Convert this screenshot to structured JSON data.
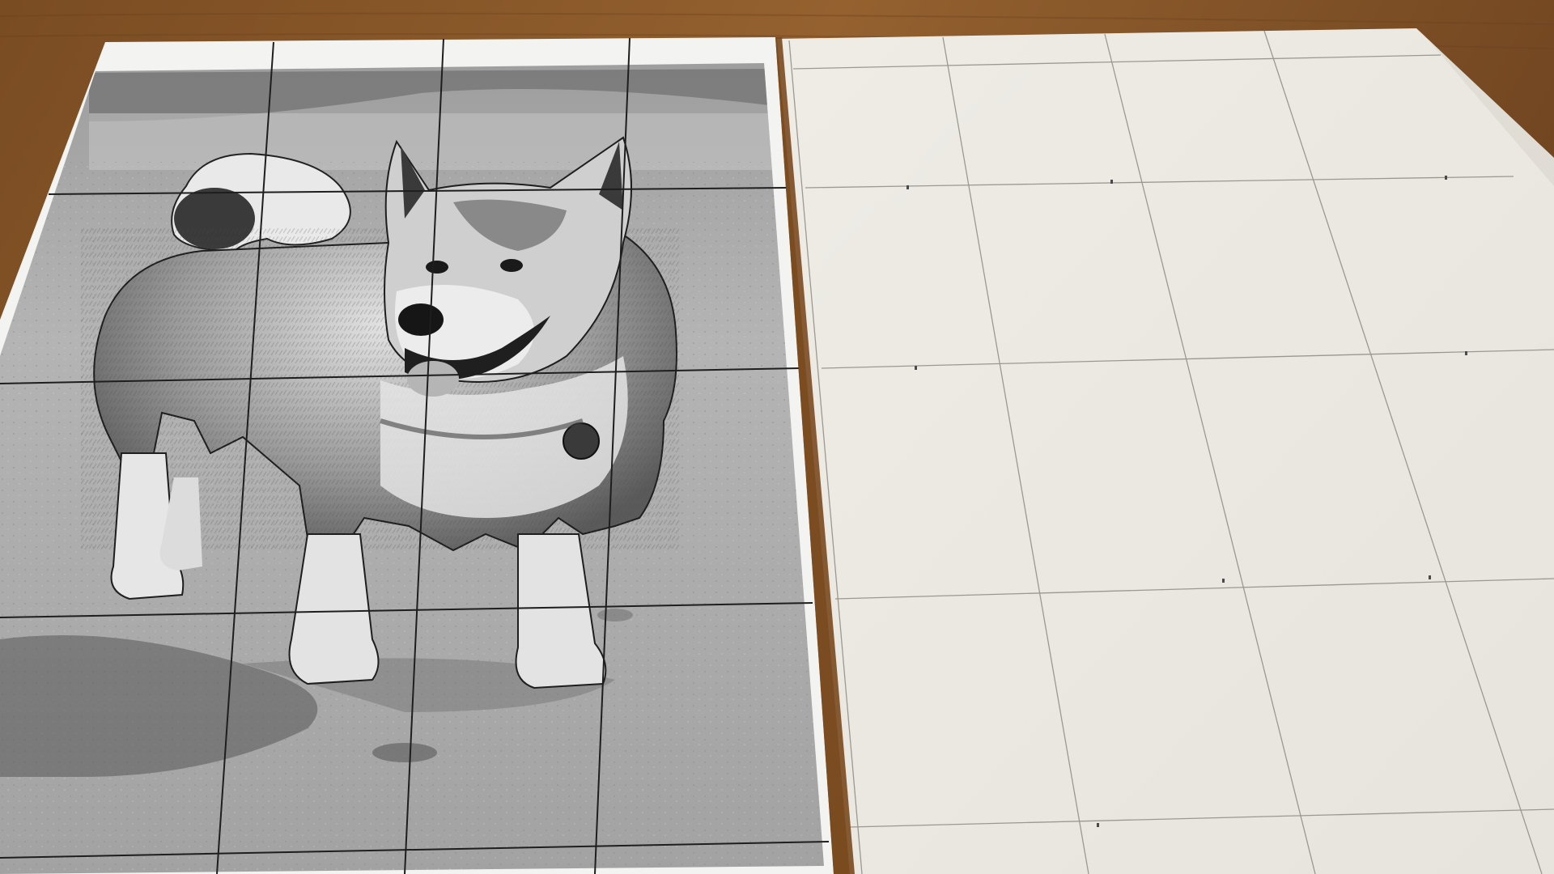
{
  "scene": {
    "subject": "dog-photo-grid-drawing-setup",
    "colors": {
      "table": "#8a5a2b",
      "table_dark": "#6e4420",
      "table_light": "#a06a35",
      "paper_print": "#f4f4f2",
      "paper_drawing": "#efede6",
      "grid_ink": "#2a2a2a",
      "pencil": "#9a9890",
      "sand_light": "#b9b9b9",
      "sand_dark": "#7d7d7d",
      "dog_fur": "#d8d8d8",
      "dog_dark": "#3c3c3c"
    }
  }
}
